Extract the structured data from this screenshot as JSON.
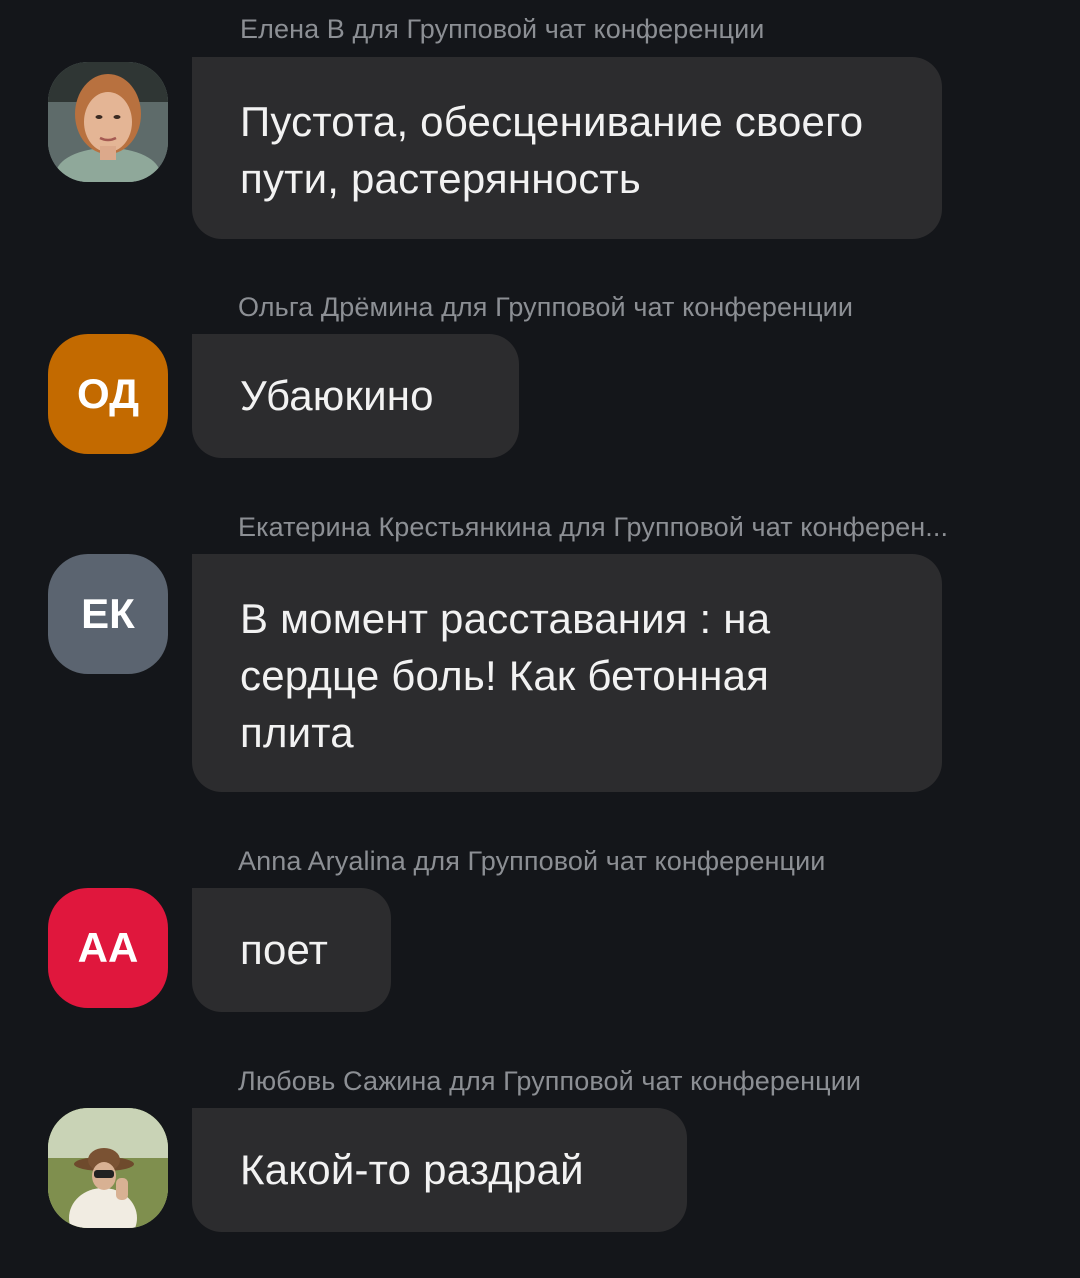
{
  "messages": [
    {
      "sender": "Елена В для Групповой чат конференции",
      "avatar": {
        "type": "photo",
        "icon": "user-photo-elena-icon"
      },
      "text": "Пустота, обесценивание своего пути, растерянность"
    },
    {
      "sender": "Ольга Дрёмина для Групповой чат конференции",
      "avatar": {
        "type": "initials",
        "initials": "ОД",
        "color": "#c36a00"
      },
      "text": "Убаюкино"
    },
    {
      "sender": "Екатерина Крестьянкина для Групповой чат конферен...",
      "avatar": {
        "type": "initials",
        "initials": "ЕК",
        "color": "#5b6470"
      },
      "text": "В момент расставания : на сердце боль! Как бетонная плита"
    },
    {
      "sender": "Anna Aryalina для Групповой чат конференции",
      "avatar": {
        "type": "initials",
        "initials": "АА",
        "color": "#e0173d"
      },
      "text": "поет"
    },
    {
      "sender": "Любовь Сажина для Групповой чат конференции",
      "avatar": {
        "type": "photo",
        "icon": "user-photo-lyubov-icon"
      },
      "text": "Какой-то раздрай"
    }
  ],
  "colors": {
    "background": "#14161a",
    "bubble": "#2c2c2e",
    "sender_text": "#8c8f94",
    "message_text": "#f2f2f2"
  }
}
